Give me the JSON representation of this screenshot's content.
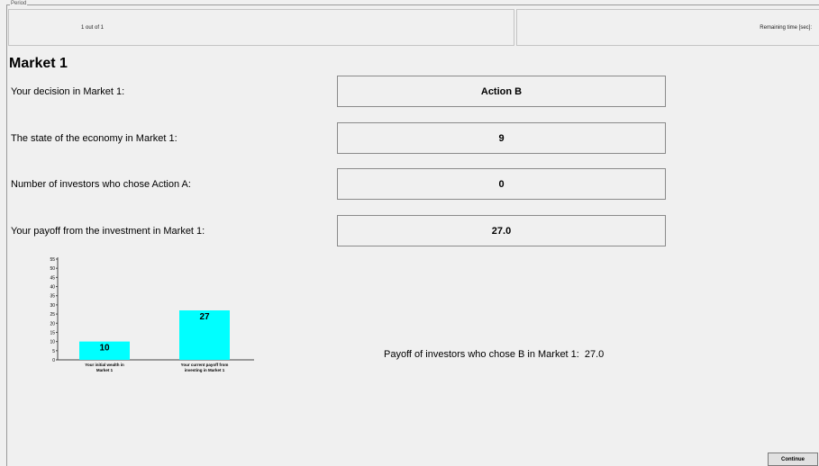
{
  "header": {
    "period_legend": "Period",
    "period_value": "1 out of 1",
    "remaining_time_label": "Remaining time [sec]:",
    "remaining_time_value": ""
  },
  "market": {
    "title": "Market 1",
    "rows": [
      {
        "label": "Your decision in Market 1:",
        "value": "Action B"
      },
      {
        "label": "The state of the economy in Market 1:",
        "value": "9"
      },
      {
        "label": "Number of investors who chose Action A:",
        "value": "0"
      },
      {
        "label": "Your payoff  from the investment in Market 1:",
        "value": "27.0"
      }
    ],
    "payoff_b_label": "Payoff of investors who chose B in Market 1:",
    "payoff_b_value": "27.0"
  },
  "chart_data": {
    "type": "bar",
    "categories": [
      [
        "Your initial wealth in",
        "Market 1"
      ],
      [
        "Your current payoff from",
        "investing in Market 1"
      ]
    ],
    "values": [
      10,
      27
    ],
    "value_labels": [
      "10",
      "27"
    ],
    "ylim": [
      0,
      55
    ],
    "yticks": [
      0,
      5,
      10,
      15,
      20,
      25,
      30,
      35,
      40,
      45,
      50,
      55
    ],
    "bar_color": "#00ffff",
    "grid": false
  },
  "buttons": {
    "continue_label": "Continue"
  }
}
